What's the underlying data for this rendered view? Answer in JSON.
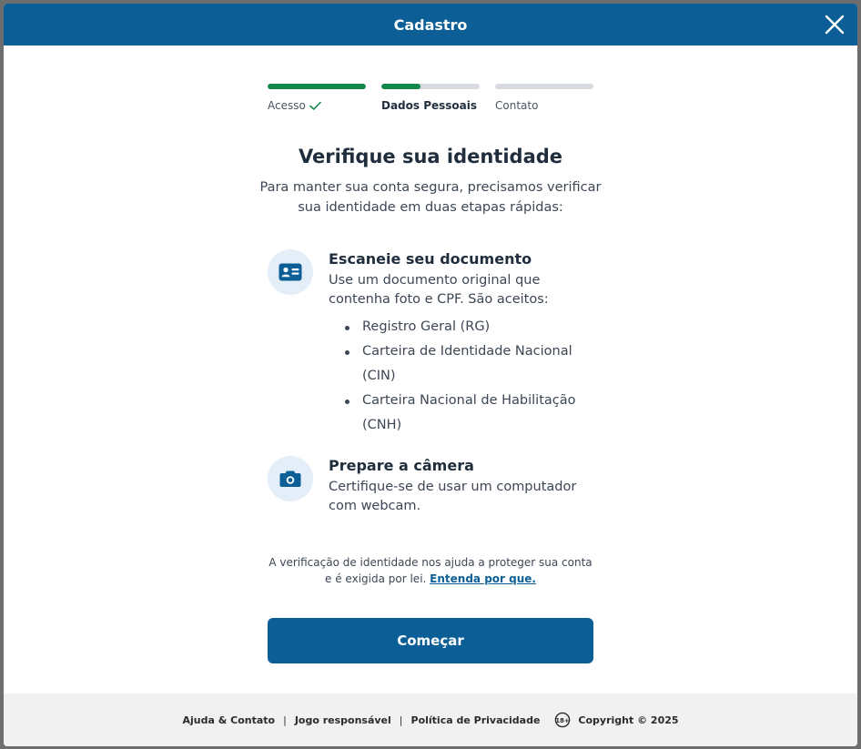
{
  "header": {
    "title": "Cadastro"
  },
  "steps": [
    {
      "label": "Acesso",
      "status": "done",
      "progress": 1.0
    },
    {
      "label": "Dados Pessoais",
      "status": "active",
      "progress": 0.4
    },
    {
      "label": "Contato",
      "status": "pending",
      "progress": 0.0
    }
  ],
  "main": {
    "title": "Verifique sua identidade",
    "subtitle": "Para manter sua conta segura, precisamos verificar sua identidade em duas etapas rápidas:"
  },
  "items": [
    {
      "icon": "id-card-icon",
      "title": "Escaneie seu documento",
      "text": "Use um documento original que contenha foto e CPF. São aceitos:",
      "list": [
        "Registro Geral (RG)",
        "Carteira de Identidade Nacional (CIN)",
        "Carteira Nacional de Habilitação (CNH)"
      ]
    },
    {
      "icon": "camera-icon",
      "title": "Prepare a câmera",
      "text": "Certifique-se de usar um computador com webcam."
    }
  ],
  "note": {
    "text": "A verificação de identidade nos ajuda a proteger sua conta e é exigida por lei.",
    "link": "Entenda por que."
  },
  "button": {
    "label": "Começar"
  },
  "footer": {
    "help": "Ajuda & Contato",
    "responsible": "Jogo responsável",
    "privacy": "Política de Privacidade",
    "age_badge": "18+",
    "copyright": "Copyright © 2025",
    "separator": "|"
  },
  "colors": {
    "primary": "#0b5f96",
    "success": "#12884a",
    "track": "#d7dbe0",
    "icon_bg": "#e3eef8",
    "footer_bg": "#f1f1f1"
  }
}
